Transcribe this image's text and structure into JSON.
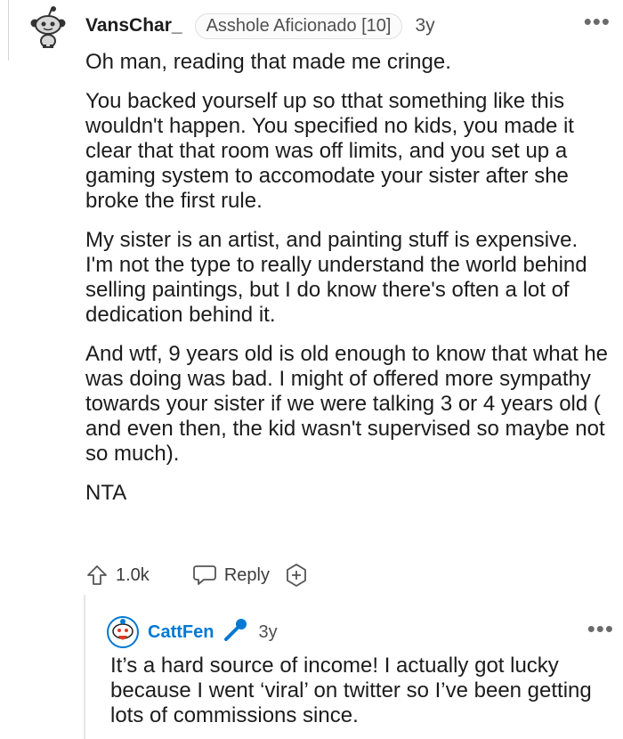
{
  "comment": {
    "username": "VansChar_",
    "flair": "Asshole Aficionado [10]",
    "time": "3y",
    "paragraphs": [
      "Oh man, reading that made me cringe.",
      "You backed yourself up so tthat something like this wouldn't happen. You specified no kids, you made it clear that that room was off limits, and you set up a gaming system to accomodate your sister after she broke the first rule.",
      "My sister is an artist, and painting stuff is expensive. I'm not the type to really understand the world behind selling paintings, but I do know there's often a lot of dedication behind it.",
      "And wtf, 9 years old is old enough to know that what he was doing was bad. I might of offered more sympathy towards your sister if we were talking 3 or 4 years old ( and even then, the kid wasn't supervised so maybe not so much).",
      "NTA"
    ],
    "upvotes": "1.0k",
    "reply_label": "Reply",
    "more_label": "•••"
  },
  "reply": {
    "username": "CattFen",
    "time": "3y",
    "text": "It’s a hard source of income! I actually got lucky because I went ‘viral’ on twitter so I’ve been getting lots of commissions since.",
    "more_label": "•••"
  },
  "icons": {
    "avatar": "snoo-avatar-icon",
    "upvote": "upvote-arrow-icon",
    "reply": "speech-bubble-icon",
    "award": "add-award-icon",
    "mic": "microphone-icon",
    "reply_avatar": "snoo-avatar-icon"
  },
  "colors": {
    "reply_username": "#0079d3",
    "mic": "#0079d3"
  }
}
